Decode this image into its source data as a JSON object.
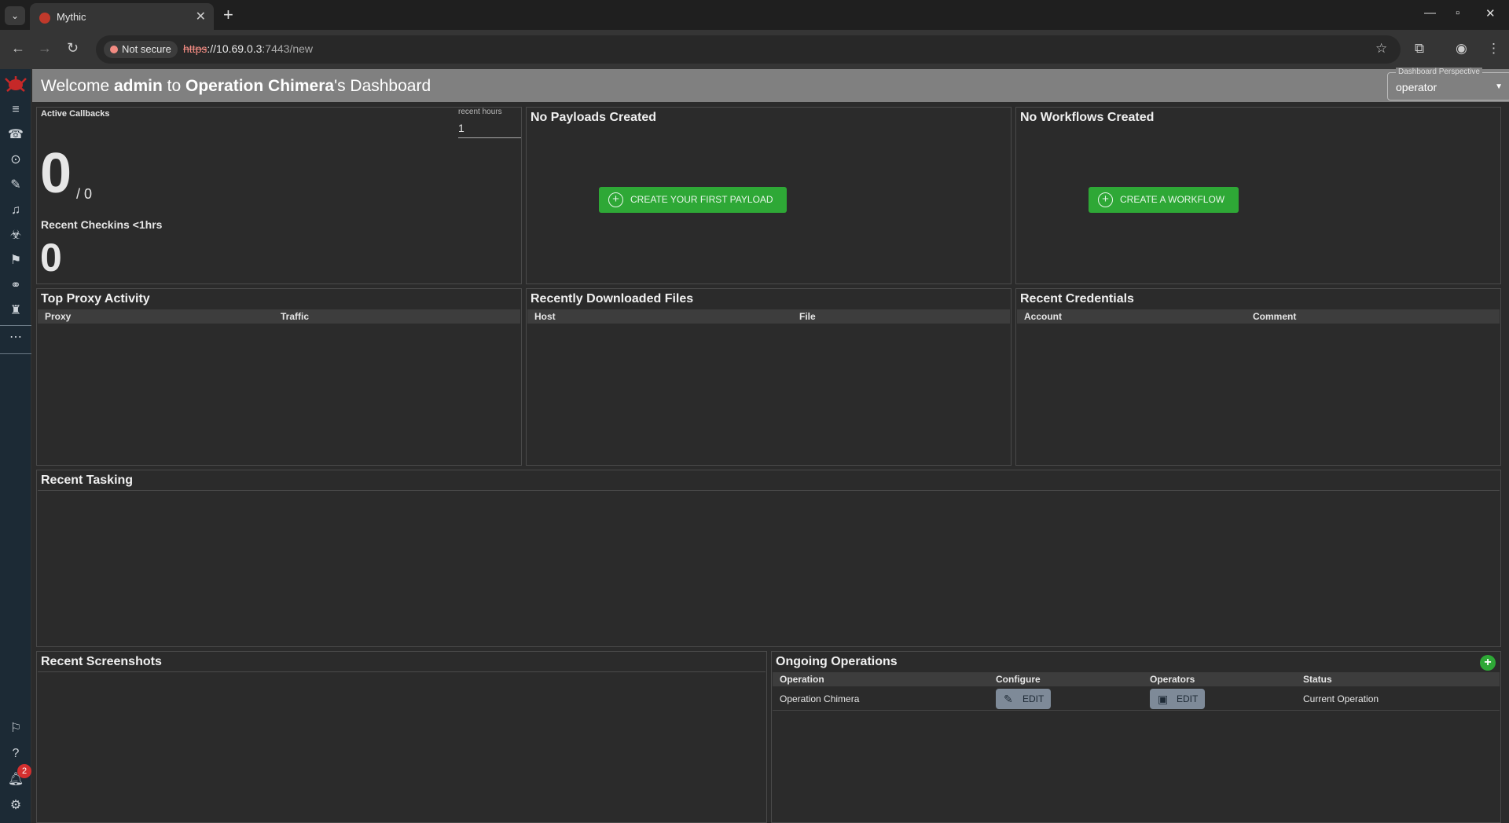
{
  "browser": {
    "tab_title": "Mythic",
    "security_label": "Not secure",
    "url_scheme": "https",
    "url_host": "://10.69.0.3",
    "url_rest": ":7443/new"
  },
  "header": {
    "welcome_prefix": "Welcome ",
    "user": "admin",
    "welcome_mid": " to ",
    "operation": "Operation Chimera",
    "welcome_suffix": "'s Dashboard",
    "perspective_label": "Dashboard Perspective",
    "perspective_value": "operator"
  },
  "sidebar": {
    "notification_count": "2"
  },
  "active_callbacks": {
    "title": "Active Callbacks",
    "hours_label": "recent hours",
    "hours_value": "1",
    "active": "0",
    "total": "/ 0",
    "recent_label": "Recent Checkins <1hrs",
    "recent_value": "0"
  },
  "payloads": {
    "title": "No Payloads Created",
    "button": "CREATE YOUR FIRST PAYLOAD"
  },
  "workflows": {
    "title": "No Workflows Created",
    "button": "CREATE A WORKFLOW"
  },
  "proxy": {
    "title": "Top Proxy Activity",
    "columns": [
      "Proxy",
      "Traffic"
    ]
  },
  "downloads": {
    "title": "Recently Downloaded Files",
    "columns": [
      "Host",
      "File"
    ]
  },
  "credentials": {
    "title": "Recent Credentials",
    "columns": [
      "Account",
      "Comment"
    ]
  },
  "tasking": {
    "title": "Recent Tasking"
  },
  "screenshots": {
    "title": "Recent Screenshots"
  },
  "operations": {
    "title": "Ongoing Operations",
    "columns": [
      "Operation",
      "Configure",
      "Operators",
      "Status"
    ],
    "rows": [
      {
        "name": "Operation Chimera",
        "configure": "EDIT",
        "operators": "EDIT",
        "status": "Current Operation"
      }
    ]
  },
  "colors": {
    "accent_green": "#2ea836",
    "header_gray": "#808080",
    "sidebar_bg": "#1c2a35"
  }
}
